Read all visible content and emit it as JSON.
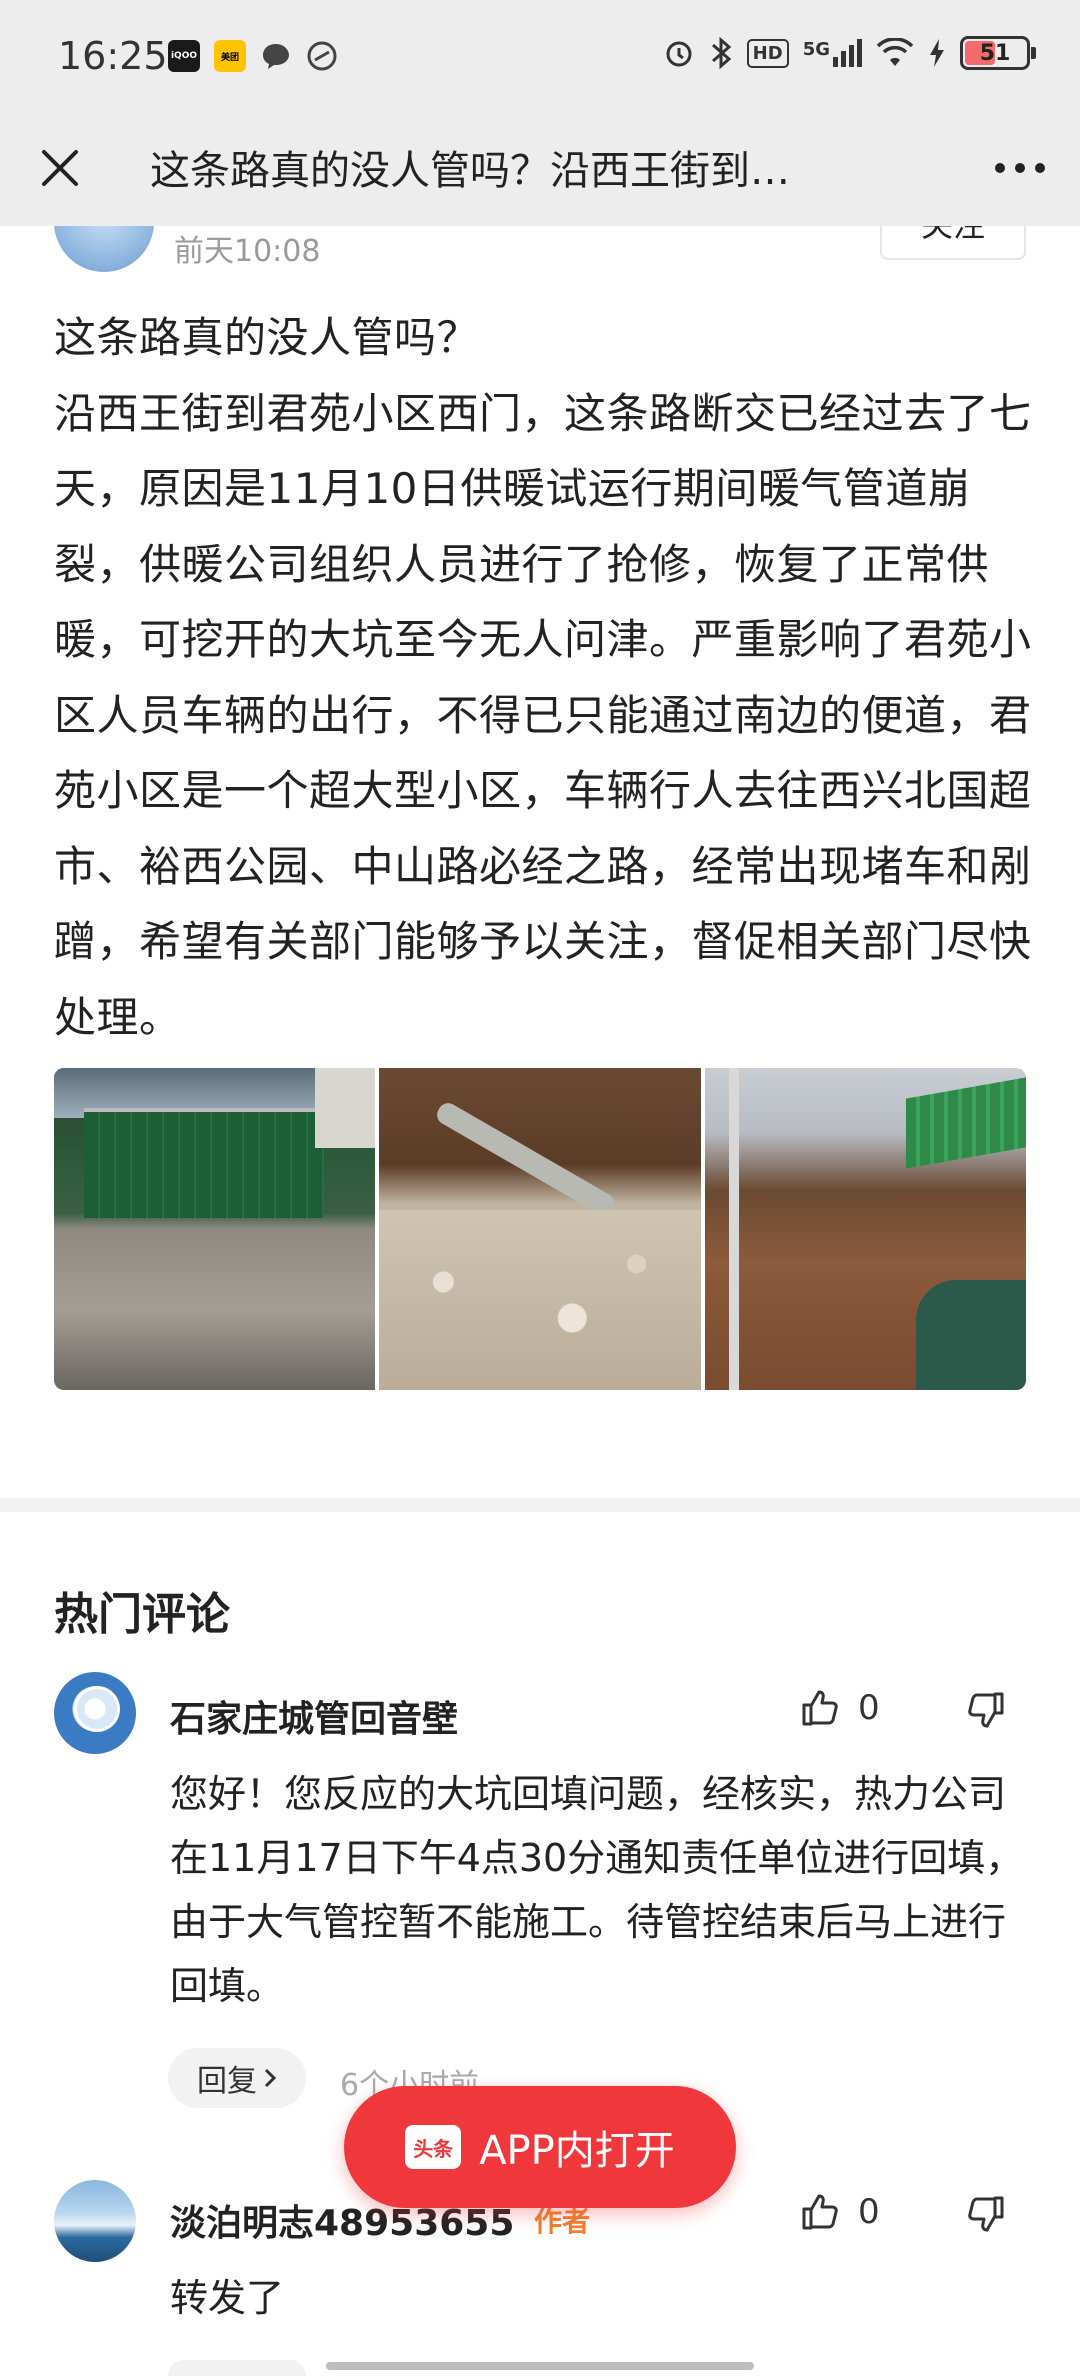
{
  "status_bar": {
    "time": "16:25",
    "app_icons": [
      "iqoo",
      "美团",
      "chat",
      "link"
    ],
    "signal": "5G",
    "hd": "HD",
    "battery": "51"
  },
  "header": {
    "title": "这条路真的没人管吗？沿西王街到…",
    "close_icon": "close-icon",
    "more_icon": "more-icon"
  },
  "post": {
    "time": "前天10:08",
    "follow_label": "关注",
    "body_lines": [
      "这条路真的没人管吗？",
      "沿西王街到君苑小区西门，这条路断交已经过去了七天，原因是11月10日供暖试运行期间暖气管道崩裂，供暖公司组织人员进行了抢修，恢复了正常供暖，可挖开的大坑至今无人问津。严重影响了君苑小区人员车辆的出行，不得已只能通过南边的便道，君苑小区是一个超大型小区，车辆行人去往西兴北国超市、裕西公园、中山路必经之路，经常出现堵车和剐蹭，希望有关部门能够予以关注，督促相关部门尽快处理。"
    ]
  },
  "comments": {
    "section_title": "热门评论",
    "items": [
      {
        "name": "石家庄城管回音壁",
        "likes": "0",
        "text": "您好！您反应的大坑回填问题，经核实，热力公司在11月17日下午4点30分通知责任单位进行回填，由于大气管控暂不能施工。待管控结束后马上进行回填。",
        "reply_label": "回复",
        "time": "6个小时前"
      },
      {
        "name": "淡泊明志48953655",
        "author_tag": "作者",
        "likes": "0",
        "text": "转发了"
      }
    ]
  },
  "open_app": {
    "logo_text": "头条",
    "label": "APP内打开"
  },
  "colors": {
    "accent": "#f0383c",
    "author_tag": "#f07f2c",
    "status_bg": "#ededed"
  }
}
